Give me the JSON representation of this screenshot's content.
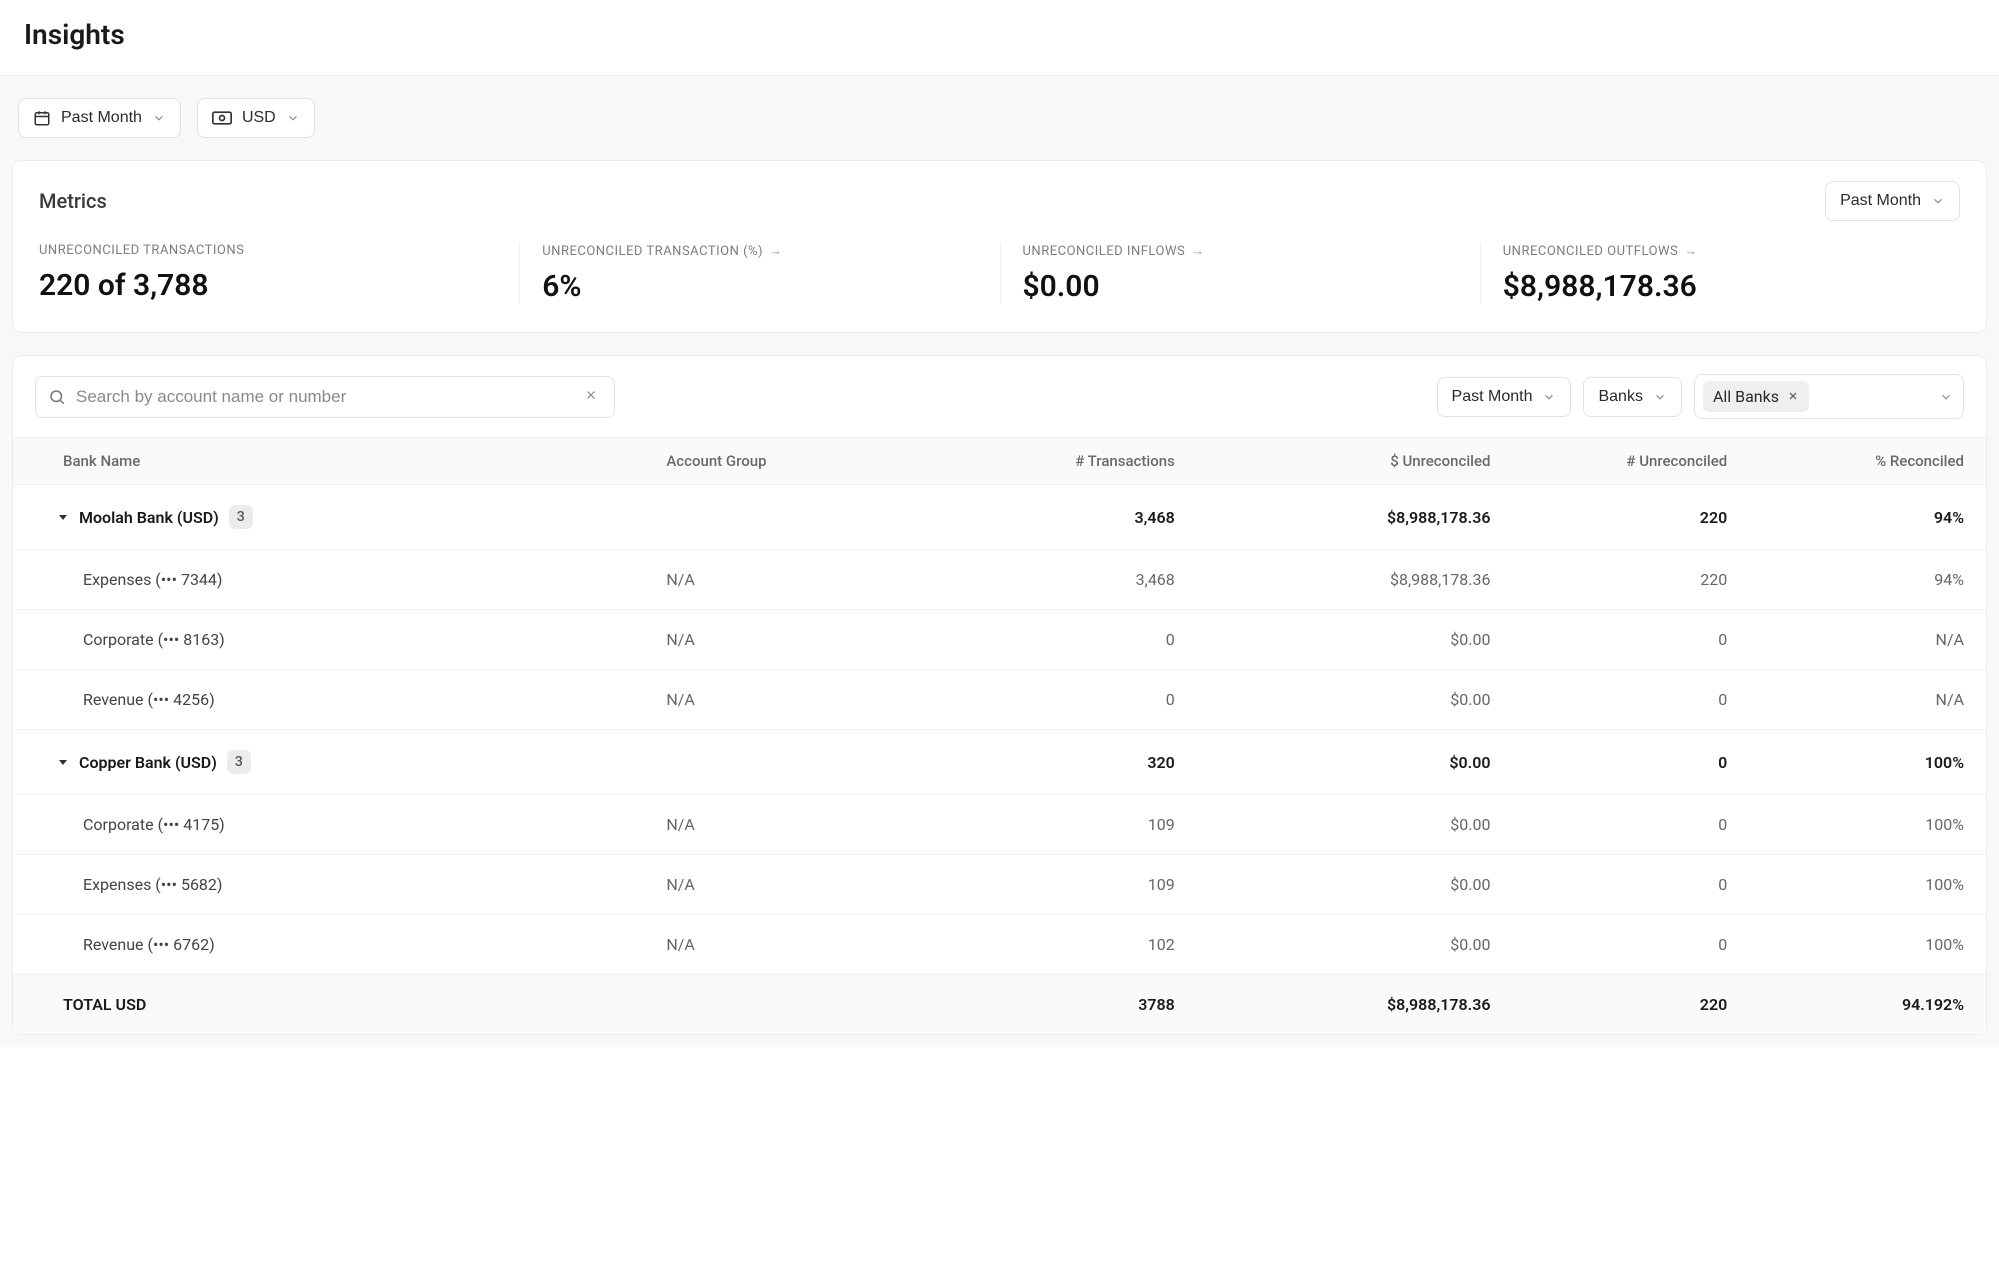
{
  "page_title": "Insights",
  "toolbar": {
    "date_range": "Past Month",
    "currency": "USD"
  },
  "metrics": {
    "section_title": "Metrics",
    "range_selector": "Past Month",
    "items": [
      {
        "label": "UNRECONCILED TRANSACTIONS",
        "value": "220 of 3,788",
        "has_arrow": false
      },
      {
        "label": "UNRECONCILED TRANSACTION (%)",
        "value": "6%",
        "has_arrow": true
      },
      {
        "label": "UNRECONCILED INFLOWS",
        "value": "$0.00",
        "has_arrow": true
      },
      {
        "label": "UNRECONCILED OUTFLOWS",
        "value": "$8,988,178.36",
        "has_arrow": true
      }
    ]
  },
  "table": {
    "search_placeholder": "Search by account name or number",
    "filters": {
      "date_range": "Past Month",
      "category": "Banks",
      "selection_chip": "All Banks"
    },
    "columns": {
      "bank_name": "Bank Name",
      "account_group": "Account Group",
      "num_transactions": "# Transactions",
      "dollar_unreconciled": "$ Unreconciled",
      "num_unreconciled": "# Unreconciled",
      "pct_reconciled": "% Reconciled"
    },
    "groups": [
      {
        "name": "Moolah Bank (USD)",
        "badge": "3",
        "num_transactions": "3,468",
        "dollar_unreconciled": "$8,988,178.36",
        "num_unreconciled": "220",
        "pct_reconciled": "94%",
        "children": [
          {
            "name": "Expenses (••• 7344)",
            "account_group": "N/A",
            "num_transactions": "3,468",
            "dollar_unreconciled": "$8,988,178.36",
            "num_unreconciled": "220",
            "pct_reconciled": "94%"
          },
          {
            "name": "Corporate (••• 8163)",
            "account_group": "N/A",
            "num_transactions": "0",
            "dollar_unreconciled": "$0.00",
            "num_unreconciled": "0",
            "pct_reconciled": "N/A"
          },
          {
            "name": "Revenue (••• 4256)",
            "account_group": "N/A",
            "num_transactions": "0",
            "dollar_unreconciled": "$0.00",
            "num_unreconciled": "0",
            "pct_reconciled": "N/A"
          }
        ]
      },
      {
        "name": "Copper Bank (USD)",
        "badge": "3",
        "num_transactions": "320",
        "dollar_unreconciled": "$0.00",
        "num_unreconciled": "0",
        "pct_reconciled": "100%",
        "children": [
          {
            "name": "Corporate (••• 4175)",
            "account_group": "N/A",
            "num_transactions": "109",
            "dollar_unreconciled": "$0.00",
            "num_unreconciled": "0",
            "pct_reconciled": "100%"
          },
          {
            "name": "Expenses (••• 5682)",
            "account_group": "N/A",
            "num_transactions": "109",
            "dollar_unreconciled": "$0.00",
            "num_unreconciled": "0",
            "pct_reconciled": "100%"
          },
          {
            "name": "Revenue (••• 6762)",
            "account_group": "N/A",
            "num_transactions": "102",
            "dollar_unreconciled": "$0.00",
            "num_unreconciled": "0",
            "pct_reconciled": "100%"
          }
        ]
      }
    ],
    "total": {
      "label": "TOTAL USD",
      "num_transactions": "3788",
      "dollar_unreconciled": "$8,988,178.36",
      "num_unreconciled": "220",
      "pct_reconciled": "94.192%"
    }
  }
}
